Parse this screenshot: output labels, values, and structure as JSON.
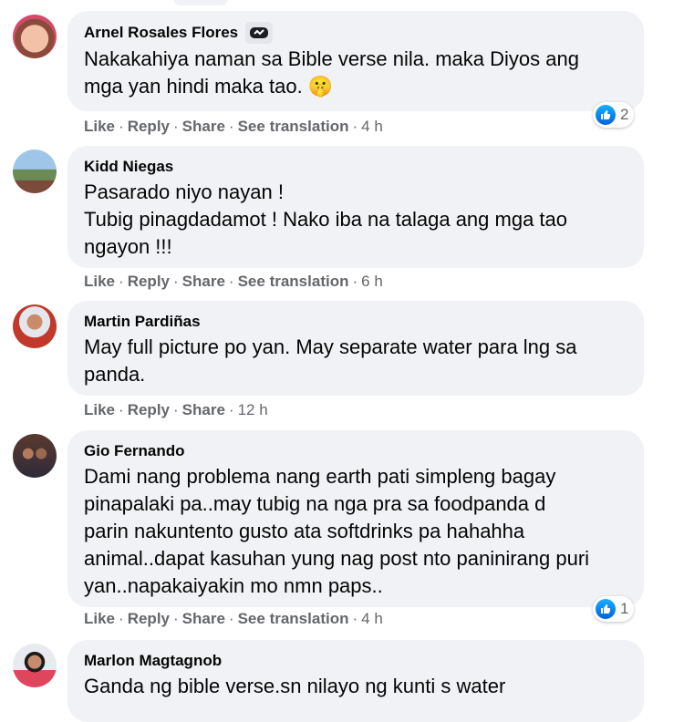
{
  "actions": {
    "like": "Like",
    "reply": "Reply",
    "share": "Share",
    "translate": "See translation",
    "dot": "·"
  },
  "comments": [
    {
      "author": "Arnel Rosales Flores",
      "badge": "top-fan-badge-icon",
      "lines": [
        "Nakakahiya naman sa Bible verse nila. maka Diyos ang",
        "mga yan hindi maka tao. 🤫"
      ],
      "time": "4 h",
      "has_translation": true,
      "reactions": "2"
    },
    {
      "author": "Kidd Niegas",
      "lines": [
        "Pasarado niyo nayan !",
        "Tubig pinagdadamot ! Nako iba na talaga ang mga tao",
        "ngayon !!!"
      ],
      "time": "6 h",
      "has_translation": true
    },
    {
      "author": "Martin Pardiñas",
      "lines": [
        "May full picture po yan. May separate water para lng sa",
        "panda."
      ],
      "time": "12 h",
      "has_translation": false
    },
    {
      "author": "Gio Fernando",
      "lines": [
        "Dami nang problema nang earth pati simpleng bagay",
        "pinapalaki pa..may tubig na nga pra sa foodpanda d",
        "parin nakuntento gusto ata softdrinks pa hahahha",
        "animal..dapat kasuhan yung nag post nto paninirang puri",
        "yan..napakaiyakin mo nmn paps.."
      ],
      "time": "4 h",
      "has_translation": true,
      "reactions": "1"
    },
    {
      "author": "Marlon Magtagnob",
      "lines": [
        "Ganda ng bible verse.sn nilayo ng kunti s water"
      ]
    }
  ],
  "colors": {
    "bubble": "#f0f2f5",
    "meta": "#65676b",
    "like_blue": "#1877f2"
  }
}
